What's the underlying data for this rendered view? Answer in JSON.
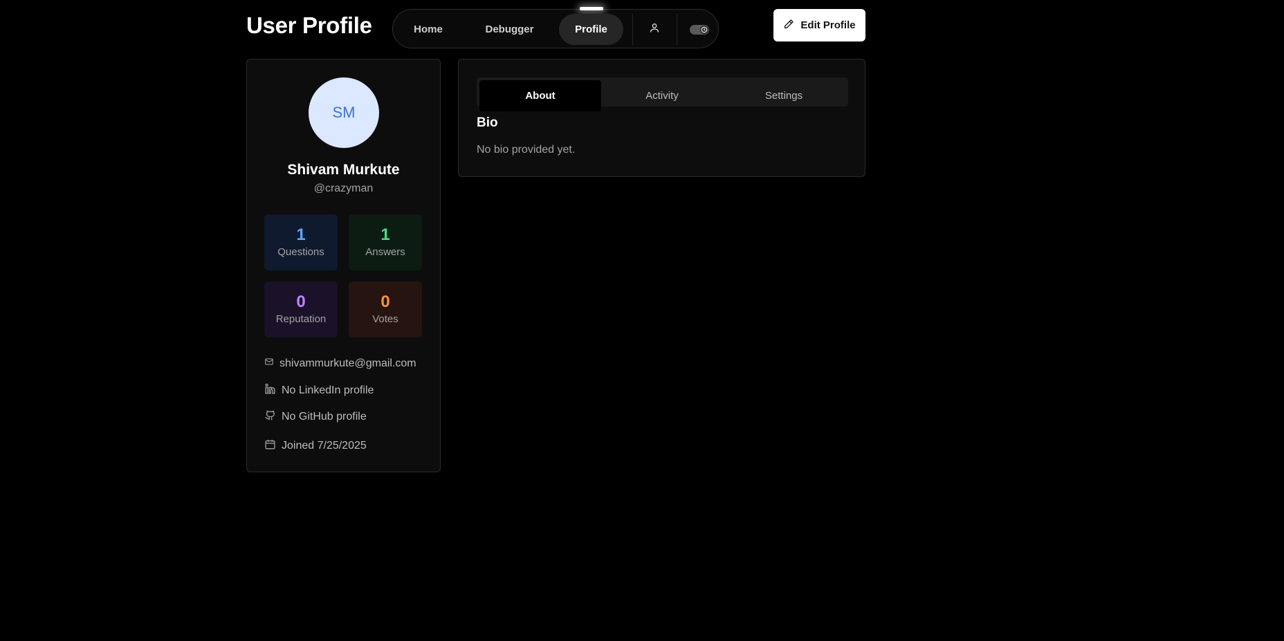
{
  "header": {
    "title": "User Profile",
    "edit_button_label": "Edit Profile"
  },
  "nav": {
    "items": [
      {
        "label": "Home",
        "active": false
      },
      {
        "label": "Debugger",
        "active": false
      },
      {
        "label": "Profile",
        "active": true
      }
    ],
    "user_icon": "user-icon",
    "theme_toggle_icon": "theme-toggle-icon"
  },
  "profile": {
    "initials": "SM",
    "name": "Shivam Murkute",
    "handle": "@crazyman",
    "stats": [
      {
        "value": "1",
        "label": "Questions",
        "color": "#60a5fa"
      },
      {
        "value": "1",
        "label": "Answers",
        "color": "#4ade80"
      },
      {
        "value": "0",
        "label": "Reputation",
        "color": "#c084fc"
      },
      {
        "value": "0",
        "label": "Votes",
        "color": "#fb923c"
      }
    ],
    "email": "shivammurkute@gmail.com",
    "linkedin": "No LinkedIn profile",
    "github": "No GitHub profile",
    "joined": "Joined 7/25/2025"
  },
  "tabs": [
    {
      "label": "About",
      "active": true
    },
    {
      "label": "Activity",
      "active": false
    },
    {
      "label": "Settings",
      "active": false
    }
  ],
  "about": {
    "bio_title": "Bio",
    "bio_text": "No bio provided yet."
  },
  "colors": {
    "background": "#000000",
    "card": "#0d0d0d",
    "avatar_bg": "#dbe8ff",
    "avatar_text": "#3b73d6"
  }
}
